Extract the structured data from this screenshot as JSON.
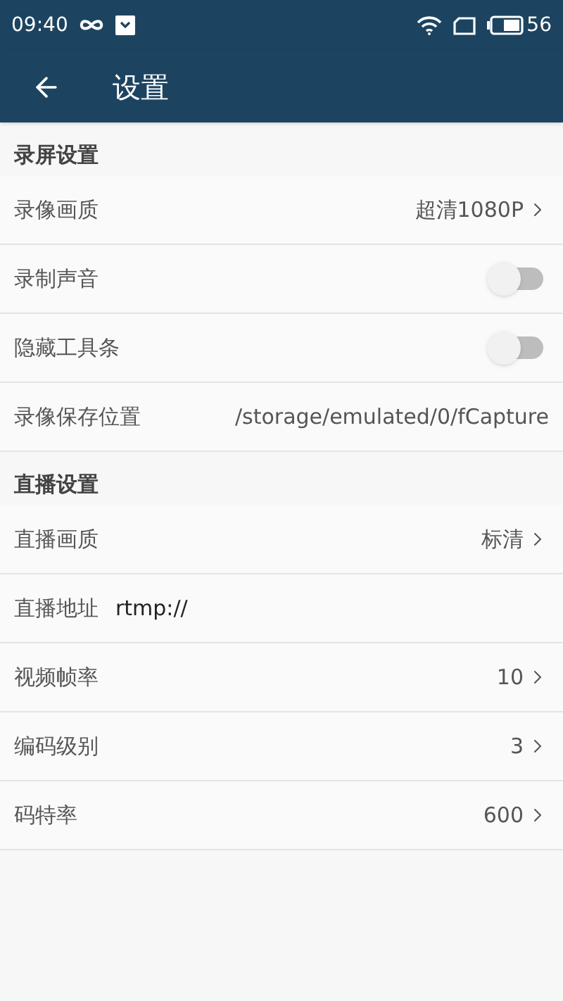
{
  "status_bar": {
    "time": "09:40",
    "battery": "56"
  },
  "app_bar": {
    "title": "设置"
  },
  "sections": [
    {
      "title": "录屏设置",
      "rows": [
        {
          "kind": "select",
          "label": "录像画质",
          "value": "超清1080P"
        },
        {
          "kind": "switch",
          "label": "录制声音",
          "on": false
        },
        {
          "kind": "switch",
          "label": "隐藏工具条",
          "on": false
        },
        {
          "kind": "path",
          "label": "录像保存位置",
          "value": "/storage/emulated/0/fCapture"
        }
      ]
    },
    {
      "title": "直播设置",
      "rows": [
        {
          "kind": "select",
          "label": "直播画质",
          "value": "标清"
        },
        {
          "kind": "input",
          "label": "直播地址",
          "value": "rtmp://"
        },
        {
          "kind": "select",
          "label": "视频帧率",
          "value": "10"
        },
        {
          "kind": "select",
          "label": "编码级别",
          "value": "3"
        },
        {
          "kind": "select",
          "label": "码特率",
          "value": "600"
        }
      ]
    }
  ]
}
